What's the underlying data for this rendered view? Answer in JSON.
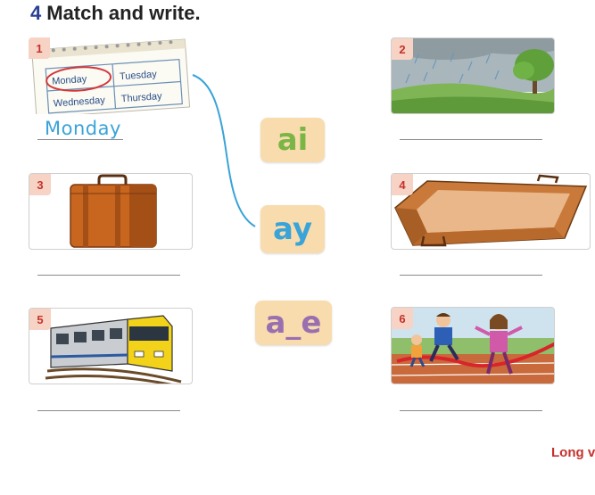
{
  "exercise": {
    "number": "4",
    "title": "Match and write."
  },
  "cards": [
    {
      "id": 1,
      "label": "1",
      "answer": "Monday",
      "calendar": {
        "days": [
          "Monday",
          "Tuesday",
          "Wednesday",
          "Thursday"
        ]
      }
    },
    {
      "id": 2,
      "label": "2",
      "answer": ""
    },
    {
      "id": 3,
      "label": "3",
      "answer": ""
    },
    {
      "id": 4,
      "label": "4",
      "answer": ""
    },
    {
      "id": 5,
      "label": "5",
      "answer": ""
    },
    {
      "id": 6,
      "label": "6",
      "answer": ""
    }
  ],
  "sounds": [
    {
      "text": "ai",
      "color": "#7bb546"
    },
    {
      "text": "ay",
      "color": "#3aa3d8"
    },
    {
      "text": "a_e",
      "color": "#9a6fb0"
    }
  ],
  "footer": {
    "text": "Long v"
  },
  "colors": {
    "badge_bg": "#f6d3c4",
    "badge_text": "#c4322c",
    "match_line": "#3aa3d8",
    "title_number": "#2b3f93"
  }
}
